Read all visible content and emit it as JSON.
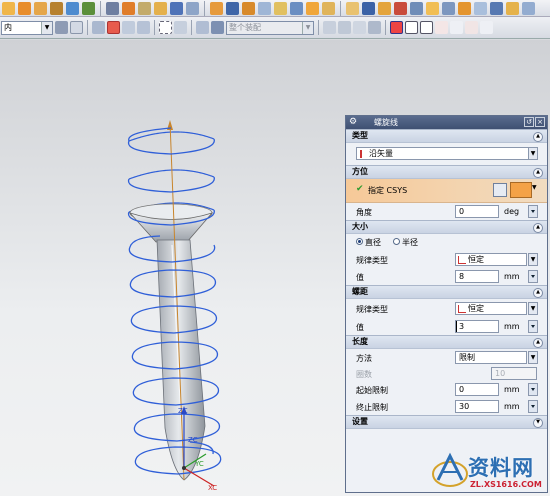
{
  "toolbar": {
    "layer_select": "内",
    "filter_select": "整个装配"
  },
  "dialog": {
    "title": "螺旋线",
    "type_section": {
      "label": "类型",
      "value": "沿矢量"
    },
    "orientation_section": {
      "label": "方位",
      "csys_label": "指定 CSYS",
      "angle_label": "角度",
      "angle_value": "0",
      "angle_unit": "deg"
    },
    "size_section": {
      "label": "大小",
      "radio_diameter": "直径",
      "radio_radius": "半径",
      "law_label": "规律类型",
      "law_value": "恒定",
      "value_label": "值",
      "value": "8",
      "unit": "mm"
    },
    "pitch_section": {
      "label": "螺距",
      "law_label": "规律类型",
      "law_value": "恒定",
      "value_label": "值",
      "value": "3",
      "unit": "mm"
    },
    "length_section": {
      "label": "长度",
      "method_label": "方法",
      "method_value": "限制",
      "turns_label": "圈数",
      "turns_value": "10",
      "start_label": "起始限制",
      "start_value": "0",
      "start_unit": "mm",
      "end_label": "终止限制",
      "end_value": "30",
      "end_unit": "mm"
    },
    "settings_section": {
      "label": "设置"
    }
  },
  "axes": {
    "zc": "ZC",
    "yc": "YC",
    "xc": "XC",
    "zc2": "ZC"
  },
  "watermark": {
    "text": "资料网",
    "url": "ZL.XS1616.COM"
  },
  "colors": {
    "helix": "#2f5fd8",
    "title_bar": "#3f5072",
    "orientation_highlight": "#f6c998",
    "screw": "#c9cdd2"
  }
}
